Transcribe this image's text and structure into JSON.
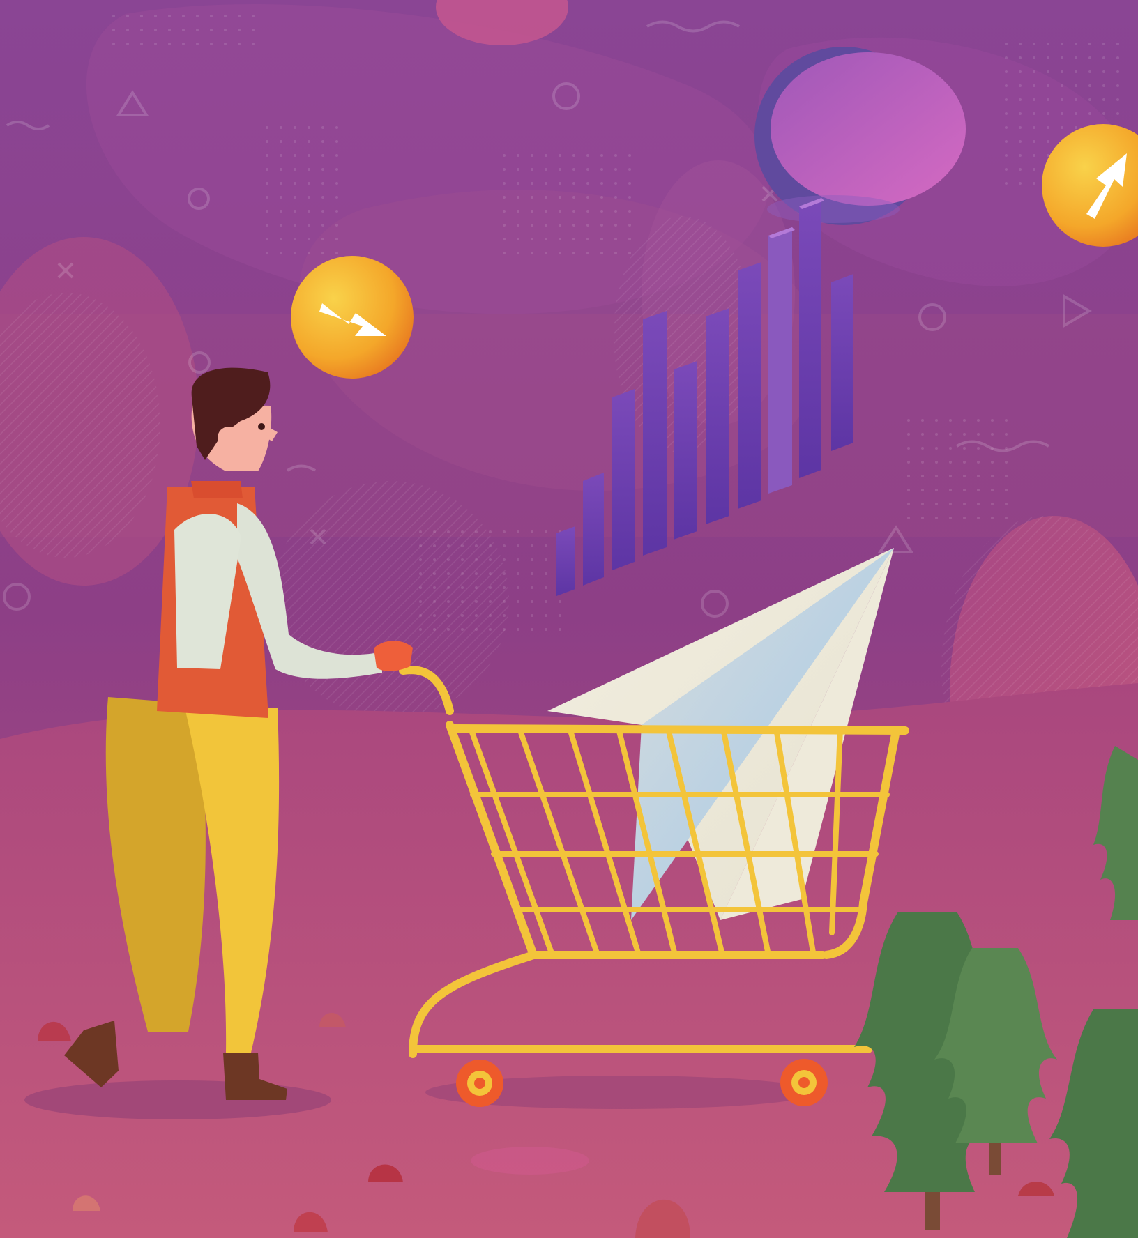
{
  "scene": {
    "colors": {
      "background_top": "#7a3f9c",
      "background_bottom": "#c65580",
      "coin_orange": "#f29c1f",
      "coin_yellow": "#f7c843",
      "cart_yellow": "#f2c43a",
      "vest_orange": "#e05a38",
      "pants_yellow": "#f0c33a",
      "tree_green": "#4f7b4b",
      "bar_purple": "#6d3ea8",
      "paper_plane_cream": "#f2eedf"
    },
    "icons": [
      "arrow-down-right-icon",
      "arrow-up-right-icon"
    ]
  }
}
